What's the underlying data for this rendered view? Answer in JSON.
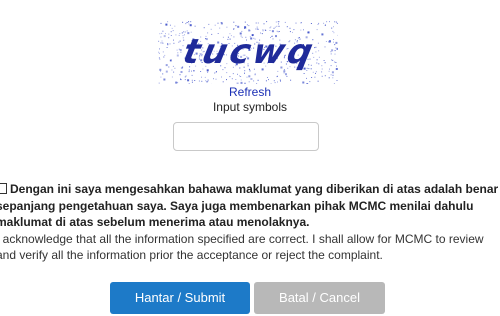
{
  "captcha": {
    "text": "tucwq",
    "ink_color": "#1f2a9a",
    "noise_color": "#2b3fc4"
  },
  "refresh_label": "Refresh",
  "input_label": "Input symbols",
  "input_value": "",
  "declaration": {
    "checked": false,
    "bold_text": "Dengan ini saya mengesahkan bahawa maklumat yang diberikan di atas adalah benar sepanjang pengetahuan saya. Saya juga membenarkan pihak MCMC menilai dahulu maklumat di atas sebelum menerima atau menolaknya.",
    "normal_text": "I acknowledge that all the information specified are correct. I shall allow for MCMC to review and verify all the information prior the acceptance or reject the complaint."
  },
  "buttons": {
    "submit_label": "Hantar / Submit",
    "cancel_label": "Batal / Cancel",
    "submit_color": "#1d7ac8",
    "cancel_color": "#b8b8b8"
  }
}
